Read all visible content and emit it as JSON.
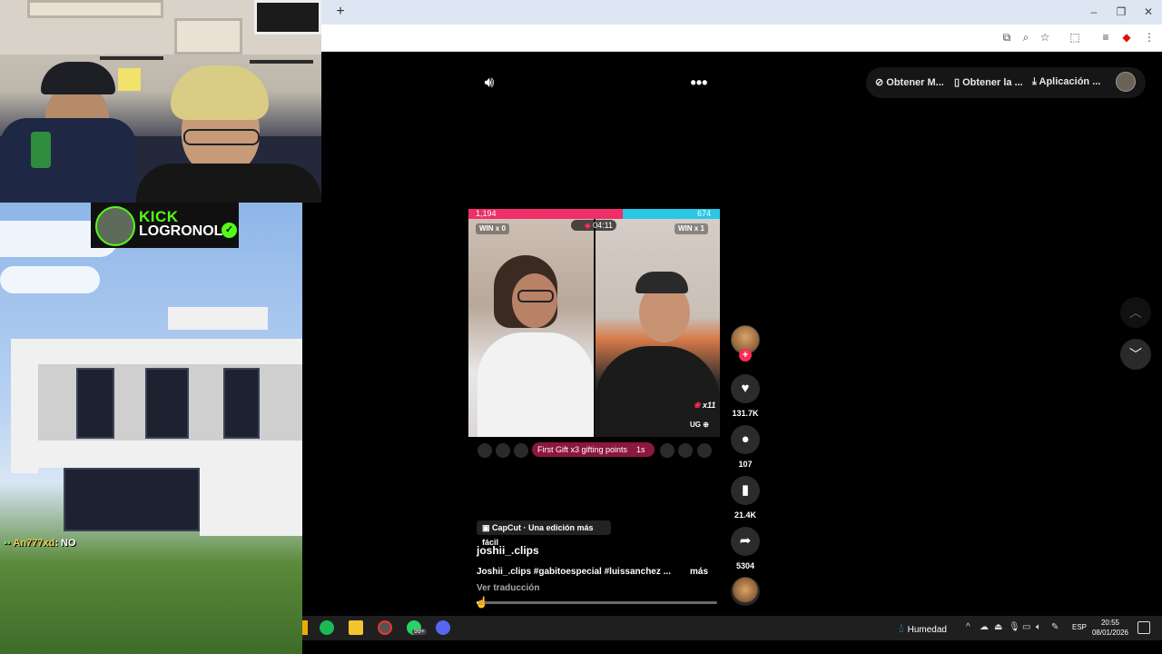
{
  "stream_overlay": {
    "kick_label": "KICK",
    "streamer_name": "LOGRONOL",
    "verified_icon": "check-badge-icon",
    "chat_user": "An777xd",
    "chat_message": ": NO"
  },
  "browser": {
    "new_tab_label": "+",
    "window_controls": [
      "minimize-icon",
      "restore-icon",
      "close-icon"
    ],
    "toolbar_icons": [
      "install-app-icon",
      "zoom-icon",
      "bookmark-star-icon",
      "extensions-icon",
      "reading-list-icon",
      "profile-extension-icon",
      "menu-kebab-icon"
    ]
  },
  "tiktok": {
    "top_actions": [
      "Obtener M...",
      "Obtener la ...",
      "Aplicación ..."
    ],
    "live_battle": {
      "score_left": "1,194",
      "score_right": "674",
      "win_left": "WIN x 0",
      "win_right": "WIN x 1",
      "timer": "04:11",
      "gift_multiplier": "x11",
      "ug_label": "UG",
      "gift_banner": "First Gift x3 gifting points",
      "gift_banner_time": "1s"
    },
    "capcut_label": "CapCut · Una edición más fácil",
    "author": "joshii_.clips",
    "description": "Joshii_.clips #gabitoespecial #luissanchez ...",
    "more_label": "más",
    "translate_label": "Ver traducción",
    "progress_fraction": 0.02,
    "actions": {
      "likes": "131.7K",
      "comments": "107",
      "saves": "21.4K",
      "shares": "5304"
    }
  },
  "taskbar": {
    "weather_label": "Humedad",
    "language": "ESP",
    "time": "20:55",
    "date": "08/01/2026",
    "whatsapp_badge": "99+"
  },
  "colors": {
    "kick_green": "#53fc18",
    "tiktok_red": "#fe2c55",
    "battle_pink": "#ef2e6a",
    "battle_blue": "#28c7e5"
  }
}
